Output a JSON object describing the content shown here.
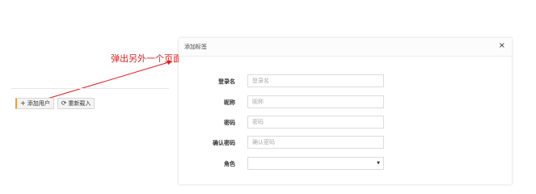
{
  "annotation": {
    "text": "弹出另外一个页面"
  },
  "toolbar": {
    "add_label": "添加用户",
    "reload_label": "重新载入"
  },
  "modal": {
    "title": "添加标签",
    "close_glyph": "×",
    "fields": [
      {
        "label": "登录名",
        "placeholder": "登录名"
      },
      {
        "label": "昵称",
        "placeholder": "昵称"
      },
      {
        "label": "密码",
        "placeholder": "密码"
      },
      {
        "label": "确认密码",
        "placeholder": "确认密码"
      }
    ],
    "role_label": "角色",
    "role_value": ""
  },
  "colors": {
    "annotation": "#e02020",
    "accent": "#e6a23c"
  },
  "icons": {
    "add": "plus-icon",
    "reload": "refresh-icon",
    "close": "close-icon",
    "caret": "caret-down-icon"
  }
}
